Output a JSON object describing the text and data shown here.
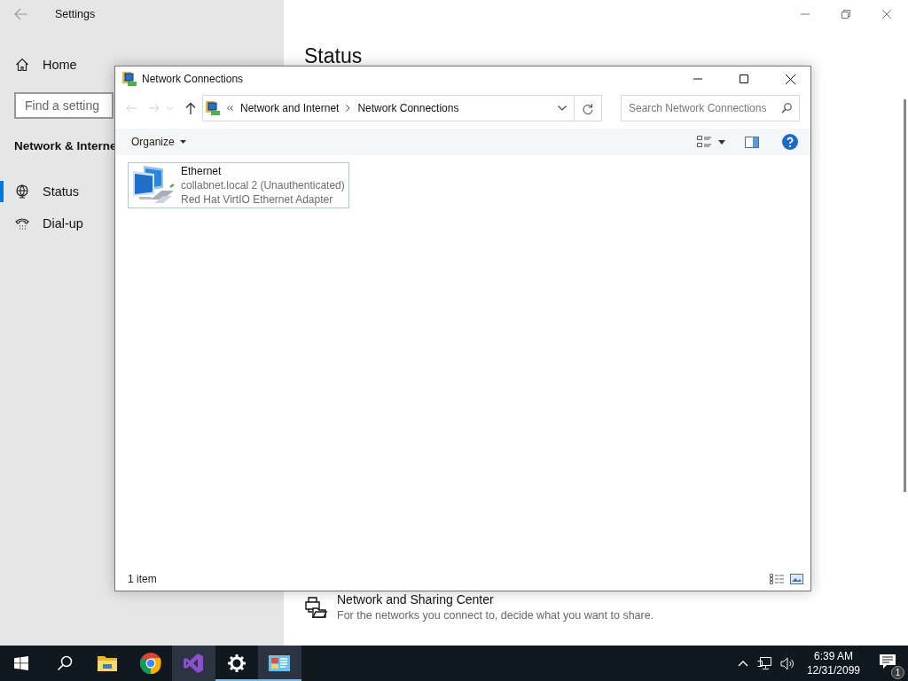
{
  "settings": {
    "title": "Settings",
    "home": "Home",
    "search_placeholder": "Find a setting",
    "section": "Network & Interne",
    "items": [
      {
        "label": "Status",
        "kind": "status",
        "selected": true
      },
      {
        "label": "Dial-up",
        "kind": "dialup",
        "selected": false
      }
    ],
    "heading": "Status",
    "sharing": {
      "title": "Network and Sharing Center",
      "description": "For the networks you connect to, decide what you want to share."
    }
  },
  "dialog": {
    "title": "Network Connections",
    "breadcrumb": [
      "Network and Internet",
      "Network Connections"
    ],
    "search_placeholder": "Search Network Connections",
    "organize": "Organize",
    "items": [
      {
        "name": "Ethernet",
        "status": "collabnet.local 2 (Unauthenticated)",
        "device": "Red Hat VirtIO Ethernet Adapter",
        "selected": true
      }
    ],
    "status_bar": "1 item"
  },
  "taskbar": {
    "apps": [
      {
        "kind": "start",
        "running": false,
        "selected": false
      },
      {
        "kind": "search",
        "running": false,
        "selected": false
      },
      {
        "kind": "folder",
        "running": false,
        "selected": false
      },
      {
        "kind": "chrome",
        "running": false,
        "selected": false
      },
      {
        "kind": "studio",
        "running": false,
        "selected": true
      },
      {
        "kind": "gear",
        "running": true,
        "selected": false
      },
      {
        "kind": "panel",
        "running": true,
        "selected": true
      }
    ],
    "time": "6:39 AM",
    "date": "12/31/2099",
    "notifications": "1"
  }
}
